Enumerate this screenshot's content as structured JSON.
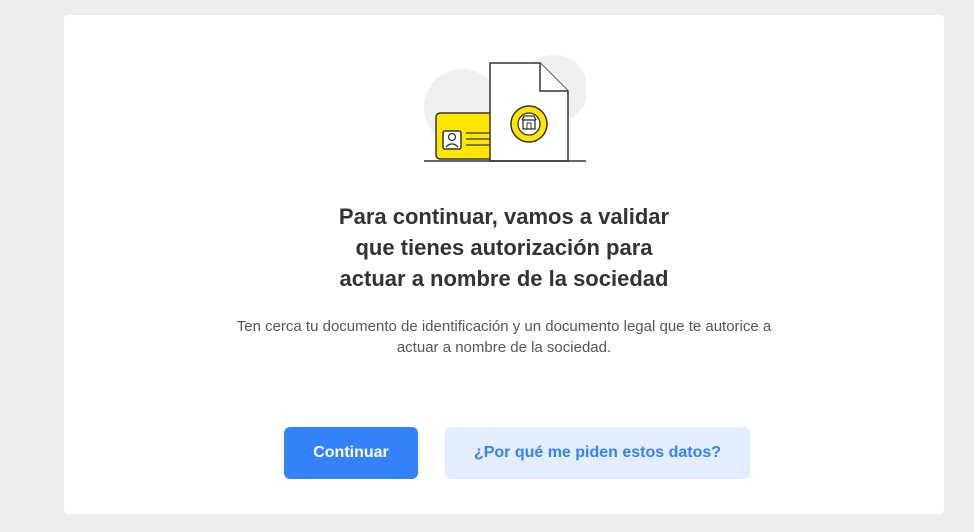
{
  "card": {
    "title_lines": [
      "Para continuar, vamos a validar",
      "que tienes autorización para",
      "actuar a nombre de la sociedad"
    ],
    "description": "Ten cerca tu documento de identificación y un documento legal que te autorice a actuar a nombre de la sociedad."
  },
  "actions": {
    "continue_label": "Continuar",
    "why_label": "¿Por qué me piden estos datos?"
  },
  "colors": {
    "primary": "#3483fa",
    "secondary_bg": "#e3edfb",
    "accent_yellow": "#ffe600"
  },
  "illustration": {
    "icons": [
      "id-card-icon",
      "legal-document-icon",
      "store-seal-icon"
    ]
  }
}
